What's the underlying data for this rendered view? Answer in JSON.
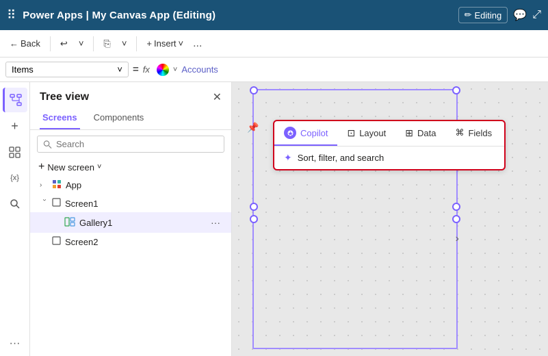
{
  "topbar": {
    "title": "Power Apps | My Canvas App (Editing)",
    "editing_label": "Editing",
    "pencil_icon": "✏️"
  },
  "toolbar": {
    "back_label": "Back",
    "undo_icon": "↩",
    "chevron_down": "˅",
    "copy_icon": "⎘",
    "insert_label": "Insert",
    "more_icon": "...",
    "editing_label": "Editing"
  },
  "formula_bar": {
    "dropdown_label": "Items",
    "eq_symbol": "=",
    "fx_symbol": "fx",
    "formula_value": "Accounts"
  },
  "sidebar": {
    "active_icon": "tree"
  },
  "tree": {
    "title": "Tree view",
    "close_icon": "✕",
    "tabs": [
      {
        "label": "Screens",
        "active": true
      },
      {
        "label": "Components",
        "active": false
      }
    ],
    "search_placeholder": "Search",
    "new_screen_label": "New screen",
    "items": [
      {
        "label": "App",
        "type": "app",
        "expandable": true,
        "indent": 0
      },
      {
        "label": "Screen1",
        "type": "screen",
        "expandable": true,
        "indent": 0
      },
      {
        "label": "Gallery1",
        "type": "gallery",
        "expandable": false,
        "indent": 1,
        "selected": true
      },
      {
        "label": "Screen2",
        "type": "screen",
        "expandable": false,
        "indent": 0
      }
    ]
  },
  "floating_toolbar": {
    "tabs": [
      {
        "label": "Copilot",
        "active": true,
        "icon": "copilot"
      },
      {
        "label": "Layout",
        "active": false,
        "icon": "layout"
      },
      {
        "label": "Data",
        "active": false,
        "icon": "data"
      },
      {
        "label": "Fields",
        "active": false,
        "icon": "fields"
      }
    ],
    "items": [
      {
        "label": "Sort, filter, and search",
        "icon": "✦"
      }
    ]
  },
  "icons": {
    "waffle": "⠿",
    "tree": "🌲",
    "plus": "+",
    "grid": "⊞",
    "variable": "{x}",
    "search": "🔍",
    "more_dots": "···"
  }
}
